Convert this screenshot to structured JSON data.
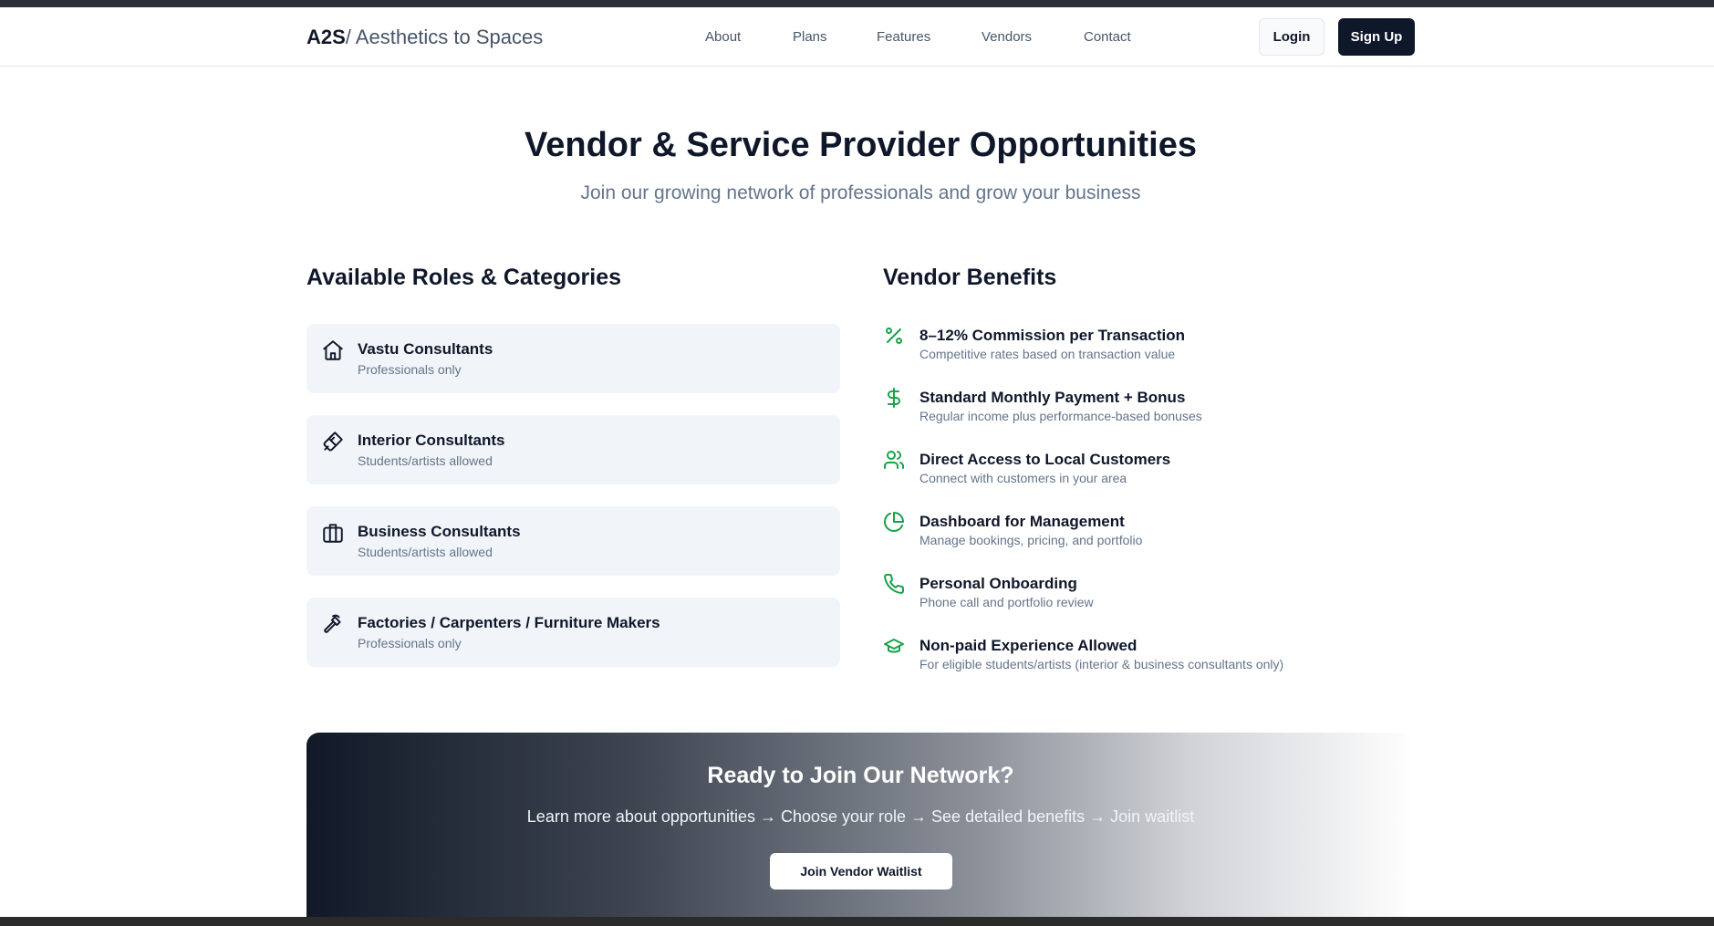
{
  "header": {
    "brand_bold": "A2S",
    "brand_rest": " / Aesthetics to Spaces",
    "nav": [
      "About",
      "Plans",
      "Features",
      "Vendors",
      "Contact"
    ],
    "login_label": "Login",
    "signup_label": "Sign Up"
  },
  "hero": {
    "title": "Vendor & Service Provider Opportunities",
    "subtitle": "Join our growing network of professionals and grow your business"
  },
  "roles": {
    "title": "Available Roles & Categories",
    "items": [
      {
        "name": "Vastu Consultants",
        "desc": "Professionals only",
        "icon": "home-icon"
      },
      {
        "name": "Interior Consultants",
        "desc": "Students/artists allowed",
        "icon": "paintbrush-icon"
      },
      {
        "name": "Business Consultants",
        "desc": "Students/artists allowed",
        "icon": "briefcase-icon"
      },
      {
        "name": "Factories / Carpenters / Furniture Makers",
        "desc": "Professionals only",
        "icon": "hammer-icon"
      }
    ]
  },
  "benefits": {
    "title": "Vendor Benefits",
    "accent_color": "#16a34a",
    "items": [
      {
        "name": "8–12% Commission per Transaction",
        "desc": "Competitive rates based on transaction value",
        "icon": "percent-icon"
      },
      {
        "name": "Standard Monthly Payment + Bonus",
        "desc": "Regular income plus performance-based bonuses",
        "icon": "dollar-icon"
      },
      {
        "name": "Direct Access to Local Customers",
        "desc": "Connect with customers in your area",
        "icon": "users-icon"
      },
      {
        "name": "Dashboard for Management",
        "desc": "Manage bookings, pricing, and portfolio",
        "icon": "pie-chart-icon"
      },
      {
        "name": "Personal Onboarding",
        "desc": "Phone call and portfolio review",
        "icon": "phone-icon"
      },
      {
        "name": "Non-paid Experience Allowed",
        "desc": "For eligible students/artists (interior & business consultants only)",
        "icon": "graduation-cap-icon"
      }
    ]
  },
  "cta": {
    "title": "Ready to Join Our Network?",
    "subtitle": "Learn more about opportunities → Choose your role → See detailed benefits → Join waitlist",
    "button_label": "Join Vendor Waitlist"
  }
}
